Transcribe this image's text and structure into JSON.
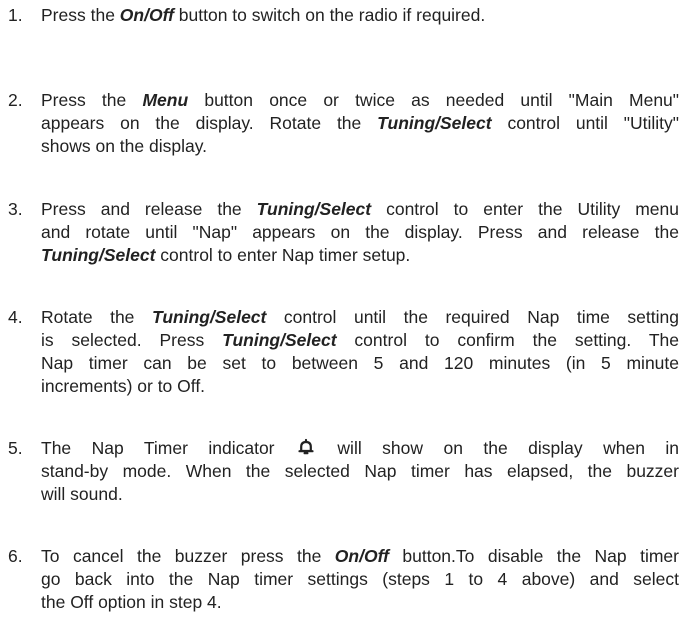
{
  "steps": [
    {
      "number": "1.",
      "lines": [
        [
          "Press the ",
          "On/Off",
          " button to switch on the radio if required."
        ]
      ]
    },
    {
      "number": "2.",
      "lines": [
        [
          "Press the ",
          "Menu",
          " button once or twice as needed until \"Main Menu\""
        ],
        [
          "appears on the display. Rotate the ",
          "Tuning/Select",
          " control until \"Utility\""
        ],
        [
          "shows on the display."
        ]
      ]
    },
    {
      "number": "3.",
      "lines": [
        [
          "Press and release the ",
          "Tuning/Select",
          " control to enter the Utility menu"
        ],
        [
          "and rotate until \"Nap\" appears on the display. Press and release the"
        ],
        [
          "",
          "Tuning/Select",
          " control to enter Nap timer setup."
        ]
      ]
    },
    {
      "number": "4.",
      "lines": [
        [
          "Rotate the ",
          "Tuning/Select",
          " control until the required Nap time setting"
        ],
        [
          "is selected. Press ",
          "Tuning/Select",
          " control to confirm the setting. The"
        ],
        [
          "Nap timer can be set to between 5 and 120 minutes (in 5 minute"
        ],
        [
          "increments) or to Off."
        ]
      ]
    },
    {
      "number": "5.",
      "icon": "bell-icon",
      "lines": [
        [
          "The Nap Timer indicator ",
          "",
          " will show on the display when in"
        ],
        [
          "stand-by mode. When the selected Nap timer has elapsed, the buzzer"
        ],
        [
          "will sound."
        ]
      ]
    },
    {
      "number": "6.",
      "lines": [
        [
          "To cancel the buzzer press the ",
          "On/Off",
          " button.To disable the Nap timer"
        ],
        [
          "go back into the Nap timer settings (steps 1 to 4 above) and select"
        ],
        [
          "the Off option in step 4."
        ]
      ]
    }
  ]
}
